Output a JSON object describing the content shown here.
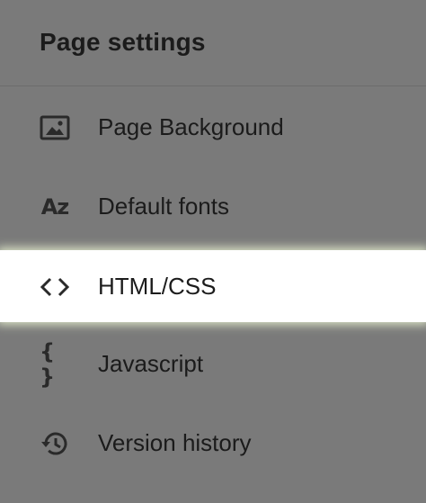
{
  "panel": {
    "title": "Page settings",
    "items": [
      {
        "label": "Page Background",
        "icon": "image-icon",
        "active": false
      },
      {
        "label": "Default fonts",
        "icon": "font-icon",
        "icon_text": "Az",
        "active": false
      },
      {
        "label": "HTML/CSS",
        "icon": "code-icon",
        "active": true
      },
      {
        "label": "Javascript",
        "icon": "braces-icon",
        "icon_text": "{ }",
        "active": false
      },
      {
        "label": "Version history",
        "icon": "history-icon",
        "active": false
      }
    ]
  },
  "colors": {
    "panel_background": "#7a7a7a",
    "active_background": "#ffffff",
    "text": "#1b1b1b"
  }
}
